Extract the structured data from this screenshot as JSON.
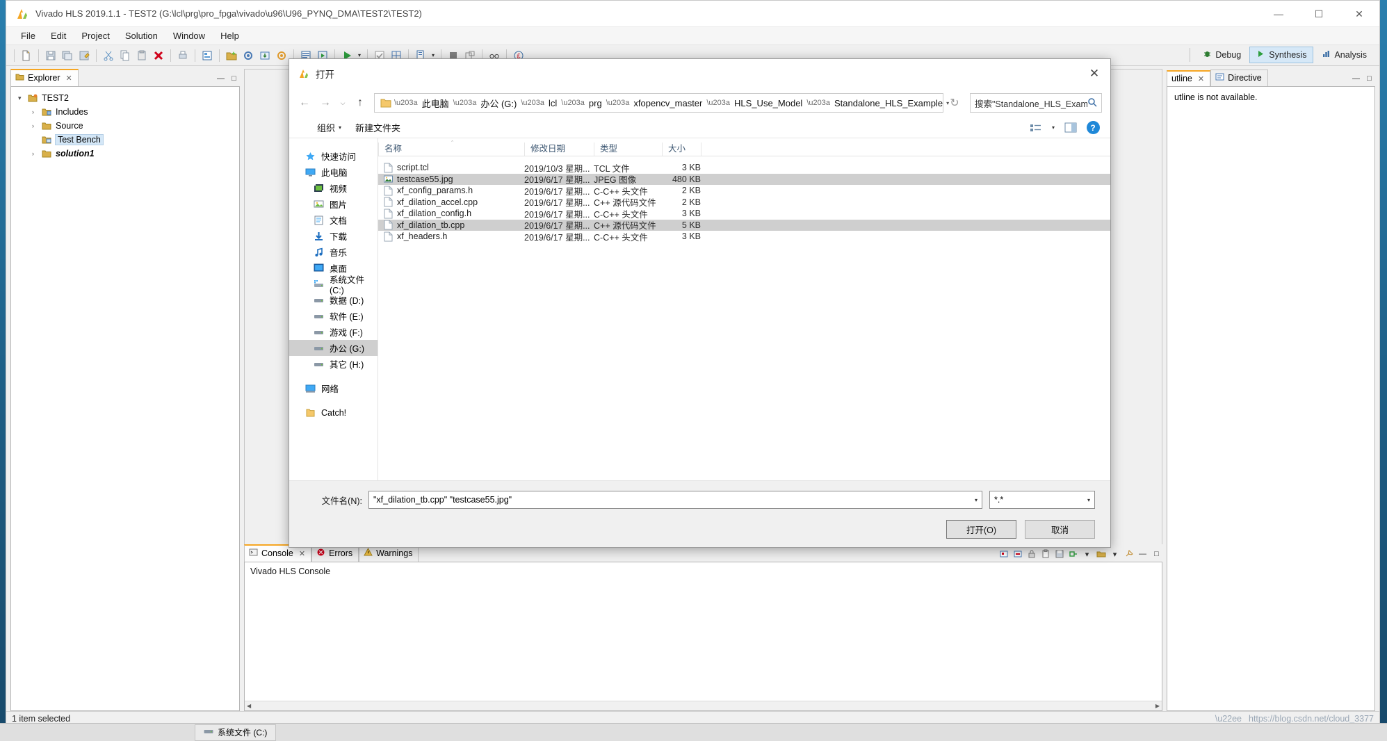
{
  "app": {
    "title": "Vivado HLS 2019.1.1 - TEST2 (G:\\lcl\\prg\\pro_fpga\\vivado\\u96\\U96_PYNQ_DMA\\TEST2\\TEST2)",
    "logo_icon": "vivado-logo-icon",
    "window_controls": [
      {
        "name": "minimize",
        "glyph": "—"
      },
      {
        "name": "maximize",
        "glyph": "☐"
      },
      {
        "name": "close",
        "glyph": "✕"
      }
    ],
    "menus": [
      "File",
      "Edit",
      "Project",
      "Solution",
      "Window",
      "Help"
    ],
    "perspectives": [
      {
        "label": "Debug",
        "icon": "bug-icon",
        "active": false
      },
      {
        "label": "Synthesis",
        "icon": "synthesis-icon",
        "active": true
      },
      {
        "label": "Analysis",
        "icon": "analysis-icon",
        "active": false
      }
    ]
  },
  "explorer": {
    "tab_label": "Explorer",
    "tab_close": "✕",
    "pane_buttons": [
      "—",
      "□"
    ],
    "tree": [
      {
        "arrow": "▾",
        "icon": "project-icon",
        "label": "TEST2",
        "indent": 0,
        "selected": false,
        "italic": false
      },
      {
        "arrow": "›",
        "icon": "includes-icon",
        "label": "Includes",
        "indent": 1,
        "selected": false,
        "italic": false
      },
      {
        "arrow": "›",
        "icon": "folder-icon",
        "label": "Source",
        "indent": 1,
        "selected": false,
        "italic": false
      },
      {
        "arrow": "",
        "icon": "testbench-icon",
        "label": "Test Bench",
        "indent": 1,
        "selected": true,
        "italic": false
      },
      {
        "arrow": "›",
        "icon": "folder-icon",
        "label": "solution1",
        "indent": 1,
        "selected": false,
        "italic": true
      }
    ]
  },
  "console": {
    "tabs": [
      {
        "label": "Console",
        "icon": "console-icon",
        "active": true,
        "close": "✕"
      },
      {
        "label": "Errors",
        "icon": "error-icon",
        "active": false,
        "close": ""
      },
      {
        "label": "Warnings",
        "icon": "warning-icon",
        "active": false,
        "close": ""
      }
    ],
    "body_title": "Vivado HLS Console",
    "tool_icons": [
      "terminate-icon",
      "remove-icon",
      "lock-icon",
      "paste-icon",
      "save-icon",
      "link-icon",
      "dropdown-icon",
      "open-console-icon",
      "caret-icon",
      "pin-icon",
      "minimize-icon",
      "maximize-icon"
    ]
  },
  "right_pane": {
    "tabs": [
      {
        "label": "utline",
        "icon": "outline-icon",
        "active": true,
        "close": "✕"
      },
      {
        "label": "Directive",
        "icon": "directive-icon",
        "active": false,
        "close": ""
      }
    ],
    "message": "utline is not available.",
    "pane_buttons": [
      "—",
      "□"
    ]
  },
  "status": {
    "text": "1 item selected",
    "watermark": "https://blog.csdn.net/cloud_3377"
  },
  "taskbar": {
    "items": [
      {
        "label": "系统文件 (C:)",
        "icon": "drive-icon"
      }
    ]
  },
  "dialog": {
    "title": "打开",
    "logo_icon": "vivado-logo-icon",
    "close_glyph": "✕",
    "nav": {
      "back": "←",
      "forward": "→",
      "recent": "⌵",
      "up": "↑",
      "refresh": "↻"
    },
    "breadcrumb": [
      "此电脑",
      "办公 (G:)",
      "lcl",
      "prg",
      "xfopencv_master",
      "HLS_Use_Model",
      "Standalone_HLS_Example"
    ],
    "breadcrumb_sep": "›",
    "search": {
      "placeholder": "搜索\"Standalone_HLS_Exam...",
      "icon": "search-icon"
    },
    "commands": [
      {
        "label": "组织",
        "caret": "▾"
      },
      {
        "label": "新建文件夹",
        "caret": ""
      }
    ],
    "view_buttons": [
      {
        "name": "view-mode-icon",
        "caret": "▾"
      },
      {
        "name": "preview-pane-icon",
        "caret": ""
      },
      {
        "name": "help-icon",
        "glyph": "?"
      }
    ],
    "sidebar": [
      {
        "label": "快速访问",
        "icon": "quick-access-icon",
        "selected": false,
        "sub": false
      },
      {
        "label": "此电脑",
        "icon": "this-pc-icon",
        "selected": false,
        "sub": false
      },
      {
        "label": "视频",
        "icon": "videos-icon",
        "selected": false,
        "sub": true
      },
      {
        "label": "图片",
        "icon": "pictures-icon",
        "selected": false,
        "sub": true
      },
      {
        "label": "文档",
        "icon": "documents-icon",
        "selected": false,
        "sub": true
      },
      {
        "label": "下载",
        "icon": "downloads-icon",
        "selected": false,
        "sub": true
      },
      {
        "label": "音乐",
        "icon": "music-icon",
        "selected": false,
        "sub": true
      },
      {
        "label": "桌面",
        "icon": "desktop-icon",
        "selected": false,
        "sub": true
      },
      {
        "label": "系统文件 (C:)",
        "icon": "system-drive-icon",
        "selected": false,
        "sub": true
      },
      {
        "label": "数据 (D:)",
        "icon": "drive-icon",
        "selected": false,
        "sub": true
      },
      {
        "label": "软件 (E:)",
        "icon": "drive-icon",
        "selected": false,
        "sub": true
      },
      {
        "label": "游戏 (F:)",
        "icon": "drive-icon",
        "selected": false,
        "sub": true
      },
      {
        "label": "办公 (G:)",
        "icon": "drive-icon",
        "selected": true,
        "sub": true
      },
      {
        "label": "其它 (H:)",
        "icon": "drive-icon",
        "selected": false,
        "sub": true
      },
      {
        "label": "网络",
        "icon": "network-icon",
        "selected": false,
        "sub": false
      },
      {
        "label": "Catch!",
        "icon": "folder-icon",
        "selected": false,
        "sub": false
      }
    ],
    "columns": [
      {
        "key": "name",
        "label": "名称"
      },
      {
        "key": "date",
        "label": "修改日期"
      },
      {
        "key": "type",
        "label": "类型"
      },
      {
        "key": "size",
        "label": "大小"
      }
    ],
    "sort_indicator": "＾",
    "files": [
      {
        "name": "script.tcl",
        "date": "2019/10/3 星期...",
        "type": "TCL 文件",
        "size": "3 KB",
        "icon": "file-icon",
        "selected": false
      },
      {
        "name": "testcase55.jpg",
        "date": "2019/6/17 星期...",
        "type": "JPEG 图像",
        "size": "480 KB",
        "icon": "image-icon",
        "selected": true
      },
      {
        "name": "xf_config_params.h",
        "date": "2019/6/17 星期...",
        "type": "C-C++ 头文件",
        "size": "2 KB",
        "icon": "file-icon",
        "selected": false
      },
      {
        "name": "xf_dilation_accel.cpp",
        "date": "2019/6/17 星期...",
        "type": "C++ 源代码文件",
        "size": "2 KB",
        "icon": "file-icon",
        "selected": false
      },
      {
        "name": "xf_dilation_config.h",
        "date": "2019/6/17 星期...",
        "type": "C-C++ 头文件",
        "size": "3 KB",
        "icon": "file-icon",
        "selected": false
      },
      {
        "name": "xf_dilation_tb.cpp",
        "date": "2019/6/17 星期...",
        "type": "C++ 源代码文件",
        "size": "5 KB",
        "icon": "file-icon",
        "selected": true
      },
      {
        "name": "xf_headers.h",
        "date": "2019/6/17 星期...",
        "type": "C-C++ 头文件",
        "size": "3 KB",
        "icon": "file-icon",
        "selected": false
      }
    ],
    "footer": {
      "filename_label": "文件名(N):",
      "filename_value": "\"xf_dilation_tb.cpp\" \"testcase55.jpg\"",
      "filter_value": "*.*",
      "caret": "▾",
      "open_button": "打开(O)",
      "cancel_button": "取消"
    }
  },
  "colors": {
    "accent": "#1f88d8",
    "selection": "#cfcfcf",
    "tab_active_border": "#f6a623",
    "header_text": "#3b5570"
  }
}
